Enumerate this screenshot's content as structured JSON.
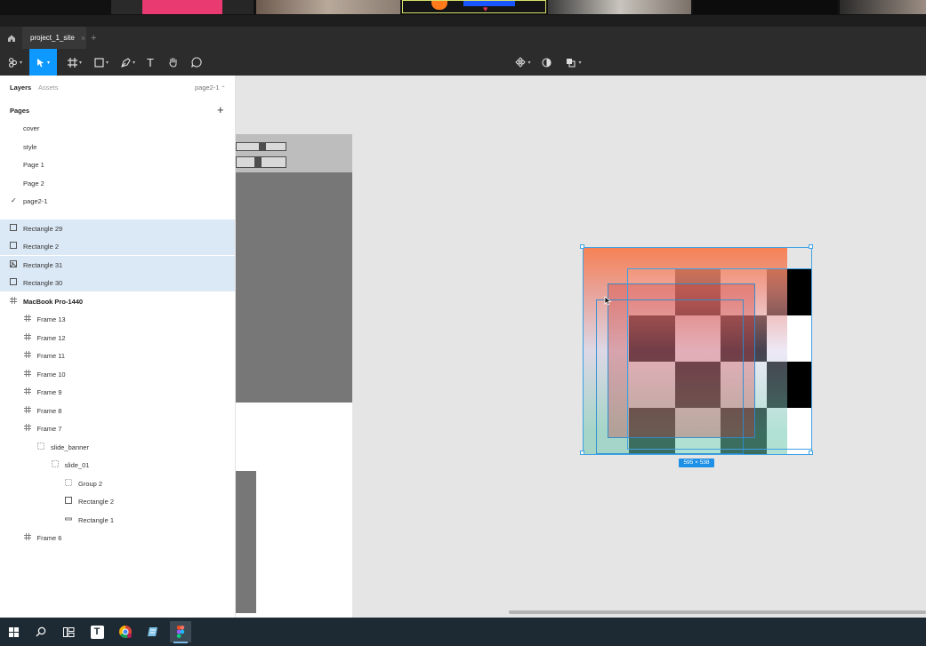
{
  "tabs": {
    "file_name": "project_1_site",
    "new_tab": "+",
    "close": "×"
  },
  "toolbar": {
    "text_tool_glyph": "T"
  },
  "panel": {
    "tab_layers": "Layers",
    "tab_assets": "Assets",
    "current_page": "page2-1",
    "pages_heading": "Pages",
    "add_page": "+",
    "pages": [
      {
        "label": "cover",
        "selected": false
      },
      {
        "label": "style",
        "selected": false
      },
      {
        "label": "Page 1",
        "selected": false
      },
      {
        "label": "Page 2",
        "selected": false
      },
      {
        "label": "page2-1",
        "selected": true
      }
    ],
    "layers": [
      {
        "label": "Rectangle 29",
        "icon": "rectangle-icon",
        "selected": true
      },
      {
        "label": "Rectangle 2",
        "icon": "rectangle-icon",
        "selected": true
      },
      {
        "label": "Rectangle 31",
        "icon": "image-icon",
        "selected": true
      },
      {
        "label": "Rectangle 30",
        "icon": "rectangle-icon",
        "selected": true
      },
      {
        "label": "MacBook Pro-1440",
        "icon": "frame-icon",
        "selected": false
      },
      {
        "label": "Frame 13",
        "icon": "frame-icon",
        "selected": false
      },
      {
        "label": "Frame 12",
        "icon": "frame-icon",
        "selected": false
      },
      {
        "label": "Frame 11",
        "icon": "frame-icon",
        "selected": false
      },
      {
        "label": "Frame 10",
        "icon": "frame-icon",
        "selected": false
      },
      {
        "label": "Frame 9",
        "icon": "frame-icon",
        "selected": false
      },
      {
        "label": "Frame 8",
        "icon": "frame-icon",
        "selected": false
      },
      {
        "label": "Frame 7",
        "icon": "frame-icon",
        "selected": false
      },
      {
        "label": "slide_banner",
        "icon": "group-icon",
        "selected": false
      },
      {
        "label": "slide_01",
        "icon": "group-icon",
        "selected": false
      },
      {
        "label": "Group 2",
        "icon": "group-icon",
        "selected": false
      },
      {
        "label": "Rectangle 2",
        "icon": "rectangle-icon",
        "selected": false
      },
      {
        "label": "Rectangle 1",
        "icon": "line-rect-icon",
        "selected": false
      },
      {
        "label": "Frame 6",
        "icon": "frame-icon",
        "selected": false
      }
    ]
  },
  "canvas": {
    "size_label": "595 × 538"
  },
  "taskbar": {
    "typora_glyph": "T"
  },
  "colors": {
    "accent": "#0d99ff",
    "selection_row": "#dbe8f5",
    "dark_ui": "#2c2c2c",
    "taskbar": "#1d2a33"
  }
}
